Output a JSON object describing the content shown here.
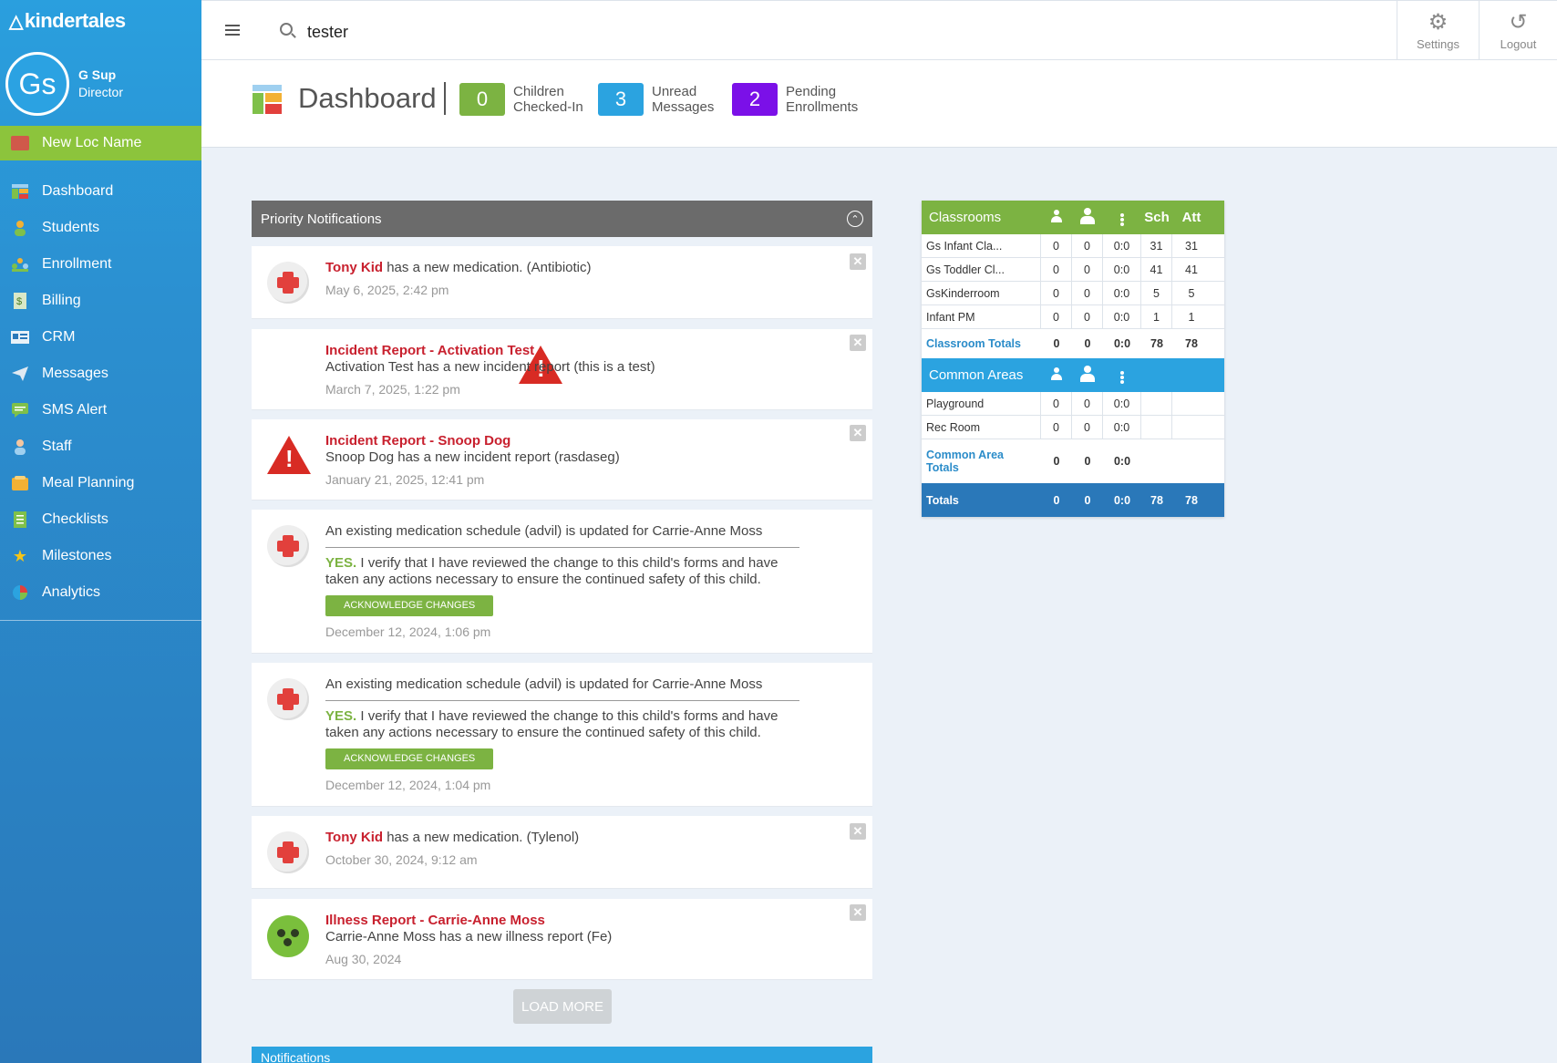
{
  "app": {
    "brand": "kindertales"
  },
  "user": {
    "initials": "Gs",
    "name": "G Sup",
    "role": "Director"
  },
  "location": {
    "name": "New Loc Name"
  },
  "nav": [
    {
      "label": "Dashboard",
      "icon": "dashboard-icon"
    },
    {
      "label": "Students",
      "icon": "student-icon"
    },
    {
      "label": "Enrollment",
      "icon": "enrollment-icon"
    },
    {
      "label": "Billing",
      "icon": "billing-icon"
    },
    {
      "label": "CRM",
      "icon": "crm-icon"
    },
    {
      "label": "Messages",
      "icon": "paper-plane-icon"
    },
    {
      "label": "SMS Alert",
      "icon": "sms-icon"
    },
    {
      "label": "Staff",
      "icon": "staff-icon"
    },
    {
      "label": "Meal Planning",
      "icon": "meal-icon"
    },
    {
      "label": "Checklists",
      "icon": "checklist-icon"
    },
    {
      "label": "Milestones",
      "icon": "star-icon"
    },
    {
      "label": "Analytics",
      "icon": "pie-chart-icon"
    }
  ],
  "topbar": {
    "search_value": "tester",
    "settings_label": "Settings",
    "logout_label": "Logout"
  },
  "header": {
    "title": "Dashboard",
    "counters": [
      {
        "value": "0",
        "line1": "Children",
        "line2": "Checked-In",
        "color": "#7cb342"
      },
      {
        "value": "3",
        "line1": "Unread",
        "line2": "Messages",
        "color": "#2ba3e0"
      },
      {
        "value": "2",
        "line1": "Pending",
        "line2": "Enrollments",
        "color": "#7b10e8"
      }
    ]
  },
  "priority": {
    "title": "Priority Notifications",
    "items": [
      {
        "type": "medication",
        "name": "Tony Kid",
        "text": " has a new medication. (Antibiotic)",
        "date": "May 6, 2025, 2:42 pm"
      },
      {
        "type": "incident",
        "title": "Incident Report - Activation Test",
        "text": "Activation Test has a new incident report (this is a test)",
        "date": "March 7, 2025, 1:22 pm"
      },
      {
        "type": "incident",
        "title": "Incident Report - Snoop Dog",
        "text": "Snoop Dog has a new incident report (rasdaseg)",
        "date": "January 21, 2025, 12:41 pm"
      },
      {
        "type": "schedule",
        "text": "An existing medication schedule (advil) is updated for Carrie-Anne Moss",
        "yes": "YES.",
        "verify": " I verify that I have reviewed the change to this child's forms and have taken any actions necessary to ensure the continued safety of this child.",
        "button": "ACKNOWLEDGE CHANGES",
        "date": "December 12, 2024, 1:06 pm"
      },
      {
        "type": "schedule",
        "text": "An existing medication schedule (advil) is updated for Carrie-Anne Moss",
        "yes": "YES.",
        "verify": " I verify that I have reviewed the change to this child's forms and have taken any actions necessary to ensure the continued safety of this child.",
        "button": "ACKNOWLEDGE CHANGES",
        "date": "December 12, 2024, 1:04 pm"
      },
      {
        "type": "medication",
        "name": "Tony Kid",
        "text": " has a new medication. (Tylenol)",
        "date": "October 30, 2024, 9:12 am"
      },
      {
        "type": "illness",
        "title": "Illness Report - Carrie-Anne Moss",
        "text": "Carrie-Anne Moss has a new illness report (Fe)",
        "date": "Aug 30, 2024"
      }
    ],
    "load_more": "LOAD MORE"
  },
  "notifications": {
    "title": "Notifications"
  },
  "classrooms": {
    "title": "Classrooms",
    "sch": "Sch",
    "att": "Att",
    "rows": [
      {
        "name": "Gs Infant Cla...",
        "c1": "0",
        "c2": "0",
        "ratio": "0:0",
        "sch": "31",
        "att": "31"
      },
      {
        "name": "Gs Toddler Cl...",
        "c1": "0",
        "c2": "0",
        "ratio": "0:0",
        "sch": "41",
        "att": "41"
      },
      {
        "name": "GsKinderroom",
        "c1": "0",
        "c2": "0",
        "ratio": "0:0",
        "sch": "5",
        "att": "5"
      },
      {
        "name": "Infant PM",
        "c1": "0",
        "c2": "0",
        "ratio": "0:0",
        "sch": "1",
        "att": "1"
      }
    ],
    "totals": {
      "label": "Classroom Totals",
      "c1": "0",
      "c2": "0",
      "ratio": "0:0",
      "sch": "78",
      "att": "78"
    }
  },
  "common_areas": {
    "title": "Common Areas",
    "rows": [
      {
        "name": "Playground",
        "c1": "0",
        "c2": "0",
        "ratio": "0:0"
      },
      {
        "name": "Rec Room",
        "c1": "0",
        "c2": "0",
        "ratio": "0:0"
      }
    ],
    "totals": {
      "label_line1": "Common Area",
      "label_line2": "Totals",
      "c1": "0",
      "c2": "0",
      "ratio": "0:0"
    }
  },
  "grand_totals": {
    "label": "Totals",
    "c1": "0",
    "c2": "0",
    "ratio": "0:0",
    "sch": "78",
    "att": "78"
  }
}
